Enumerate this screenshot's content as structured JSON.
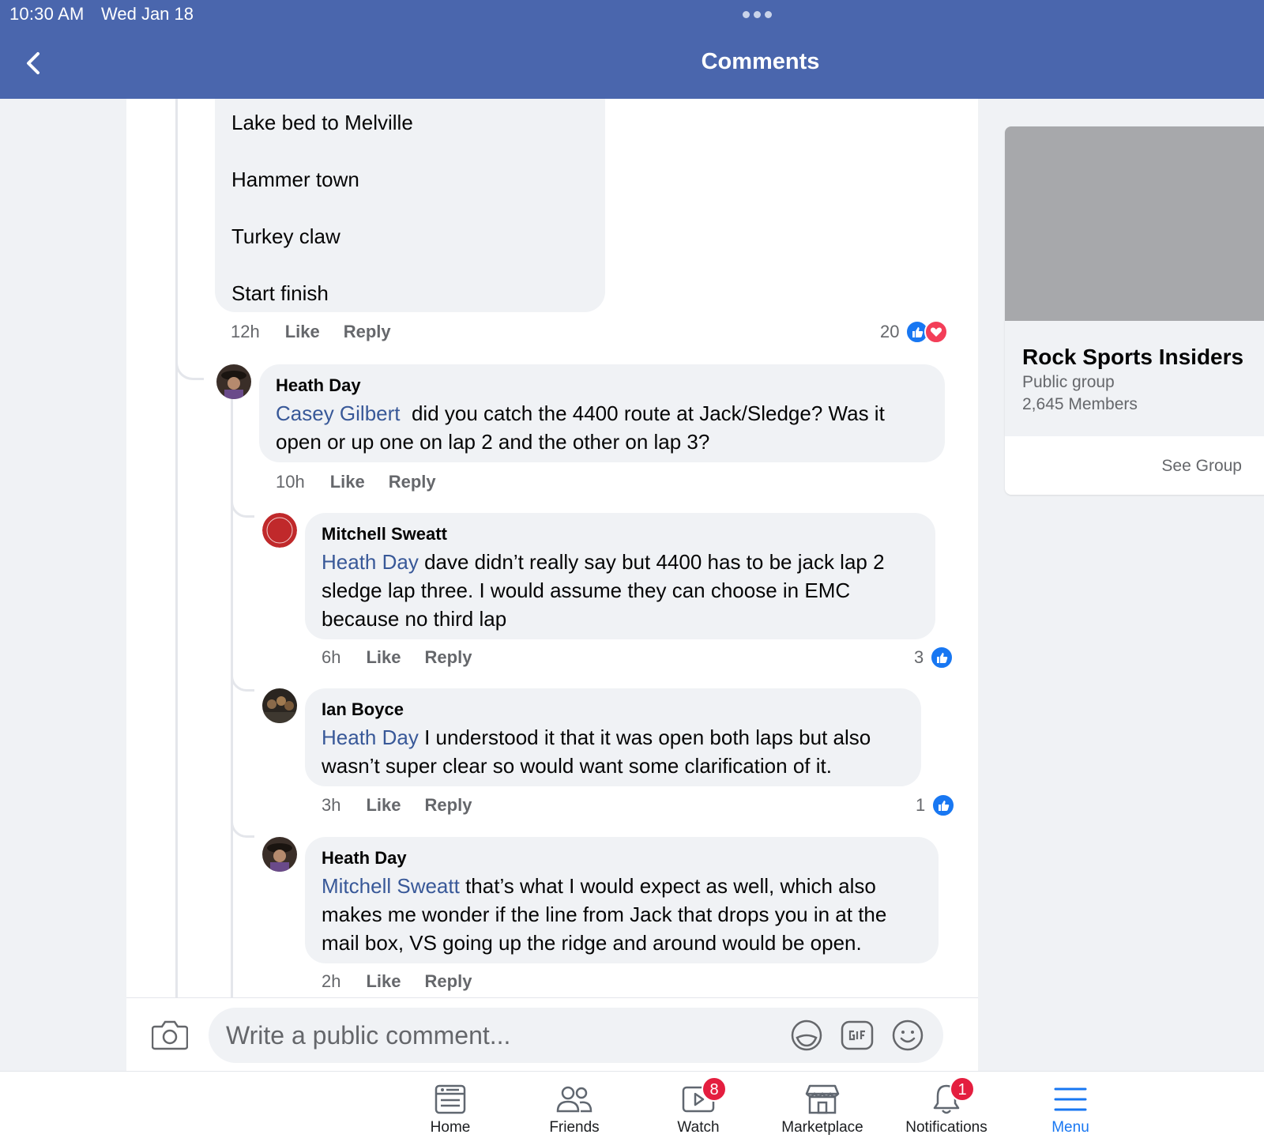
{
  "status": {
    "time": "10:30 AM",
    "date": "Wed Jan 18"
  },
  "header": {
    "title": "Comments"
  },
  "first_comment": {
    "lines": [
      "Lake bed to Melville",
      "Hammer town",
      "Turkey claw",
      "Start finish"
    ],
    "time": "12h",
    "like_label": "Like",
    "reply_label": "Reply",
    "reaction_count": "20"
  },
  "comments": [
    {
      "author": "Heath Day",
      "mention": "Casey Gilbert",
      "text": "did you catch the 4400 route at Jack/Sledge?  Was it open or up one on lap 2 and the other on lap 3?",
      "time": "10h",
      "like_label": "Like",
      "reply_label": "Reply"
    },
    {
      "author": "Mitchell Sweatt",
      "mention": "Heath Day",
      "text": "dave didn’t really say but 4400 has to be jack lap 2 sledge lap three. I would assume they can choose in EMC because no third lap",
      "time": "6h",
      "like_label": "Like",
      "reply_label": "Reply",
      "reaction_count": "3"
    },
    {
      "author": "Ian Boyce",
      "mention": "Heath Day",
      "text": "I understood it that it was open both laps but also wasn’t super clear so would want some clarification of it.",
      "time": "3h",
      "like_label": "Like",
      "reply_label": "Reply",
      "reaction_count": "1"
    },
    {
      "author": "Heath Day",
      "mention": "Mitchell Sweatt",
      "text": "that’s what I would expect as well,  which also makes me wonder if the line from Jack that drops you in at the mail box, VS  going up the ridge and around would be open.",
      "time": "2h",
      "like_label": "Like",
      "reply_label": "Reply"
    }
  ],
  "composer": {
    "placeholder": "Write a public comment..."
  },
  "group": {
    "name": "Rock Sports Insiders",
    "type": "Public group",
    "members": "2,645 Members",
    "see_group_label": "See Group"
  },
  "nav": {
    "items": [
      {
        "label": "Home"
      },
      {
        "label": "Friends"
      },
      {
        "label": "Watch",
        "badge": "8"
      },
      {
        "label": "Marketplace"
      },
      {
        "label": "Notifications",
        "badge": "1"
      },
      {
        "label": "Menu"
      }
    ]
  },
  "colors": {
    "header": "#4a66ad",
    "mention": "#385898",
    "like": "#1877f2",
    "love": "#f33e58",
    "badge": "#e41e3f"
  }
}
